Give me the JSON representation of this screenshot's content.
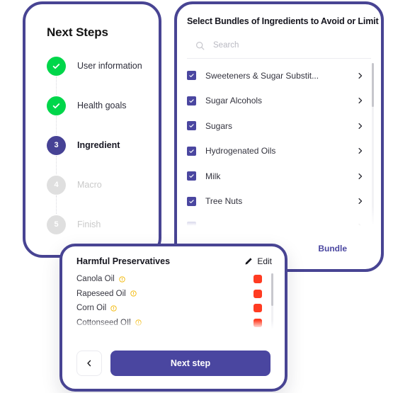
{
  "theme": {
    "indigo": "#4A46A0",
    "border_indigo": "#484493",
    "green": "#00D64A",
    "red": "#FF3B21",
    "amber": "#F2B705",
    "muted": "#C9C9C9"
  },
  "steps_card": {
    "title": "Next Steps",
    "items": [
      {
        "number": "1",
        "label": "User information",
        "state": "done",
        "icon": "check-icon"
      },
      {
        "number": "2",
        "label": "Health goals",
        "state": "done",
        "icon": "check-icon"
      },
      {
        "number": "3",
        "label": "Ingredient",
        "state": "current",
        "icon": ""
      },
      {
        "number": "4",
        "label": "Macro",
        "state": "todo",
        "icon": ""
      },
      {
        "number": "5",
        "label": "Finish",
        "state": "todo",
        "icon": ""
      }
    ]
  },
  "bundles_card": {
    "title": "Select Bundles of Ingredients to Avoid or Limit",
    "search": {
      "placeholder": "Search",
      "value": "",
      "icon": "search-icon"
    },
    "items": [
      {
        "label": "Sweeteners & Sugar Substit...",
        "checked": true,
        "chevron": "chevron-right-icon"
      },
      {
        "label": "Sugar Alcohols",
        "checked": true,
        "chevron": "chevron-right-icon"
      },
      {
        "label": "Sugars",
        "checked": true,
        "chevron": "chevron-right-icon"
      },
      {
        "label": "Hydrogenated Oils",
        "checked": true,
        "chevron": "chevron-right-icon"
      },
      {
        "label": "Milk",
        "checked": true,
        "chevron": "chevron-right-icon"
      },
      {
        "label": "Tree Nuts",
        "checked": true,
        "chevron": "chevron-right-icon"
      },
      {
        "label": "",
        "checked": true,
        "chevron": "chevron-right-icon"
      }
    ],
    "add_bundle_label": "Bundle"
  },
  "preservatives_card": {
    "title": "Harmful Preservatives",
    "edit_label": "Edit",
    "edit_icon": "pencil-icon",
    "items": [
      {
        "name": "Canola Oil",
        "info_icon": "info-icon",
        "severity_color": "#FF3B21"
      },
      {
        "name": "Rapeseed Oil",
        "info_icon": "info-icon",
        "severity_color": "#FF3B21"
      },
      {
        "name": "Corn Oil",
        "info_icon": "info-icon",
        "severity_color": "#FF3B21"
      },
      {
        "name": "Cottonseed OIl",
        "info_icon": "info-icon",
        "severity_color": "#FF3B21"
      }
    ],
    "back_label": "",
    "back_icon": "chevron-left-icon",
    "next_label": "Next step"
  }
}
